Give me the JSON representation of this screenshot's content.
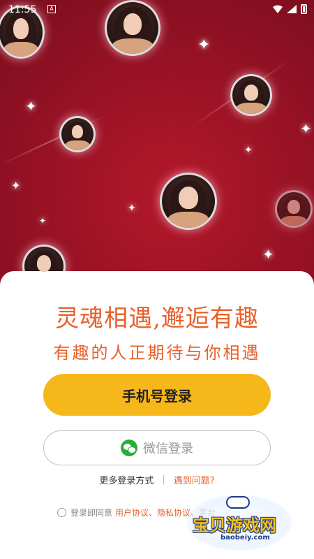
{
  "status_bar": {
    "time": "11:55",
    "app_icon": "A"
  },
  "headline": "灵魂相遇,邂逅有趣",
  "subline": "有趣的人正期待与你相遇",
  "buttons": {
    "phone_login": "手机号登录",
    "wechat_login": "微信登录"
  },
  "links": {
    "more_login": "更多登录方式",
    "divider": "|",
    "problem": "遇到问题?"
  },
  "agreement": {
    "prefix": "登录即同意",
    "user_agreement": "用户协议、",
    "privacy": "隐私协议、",
    "platform": "平台"
  },
  "watermark": {
    "title": "宝贝游戏网",
    "url": "baobeiy.com"
  },
  "colors": {
    "accent_orange": "#e8602a",
    "button_yellow": "#f6b71b",
    "background": "#8c1022"
  }
}
